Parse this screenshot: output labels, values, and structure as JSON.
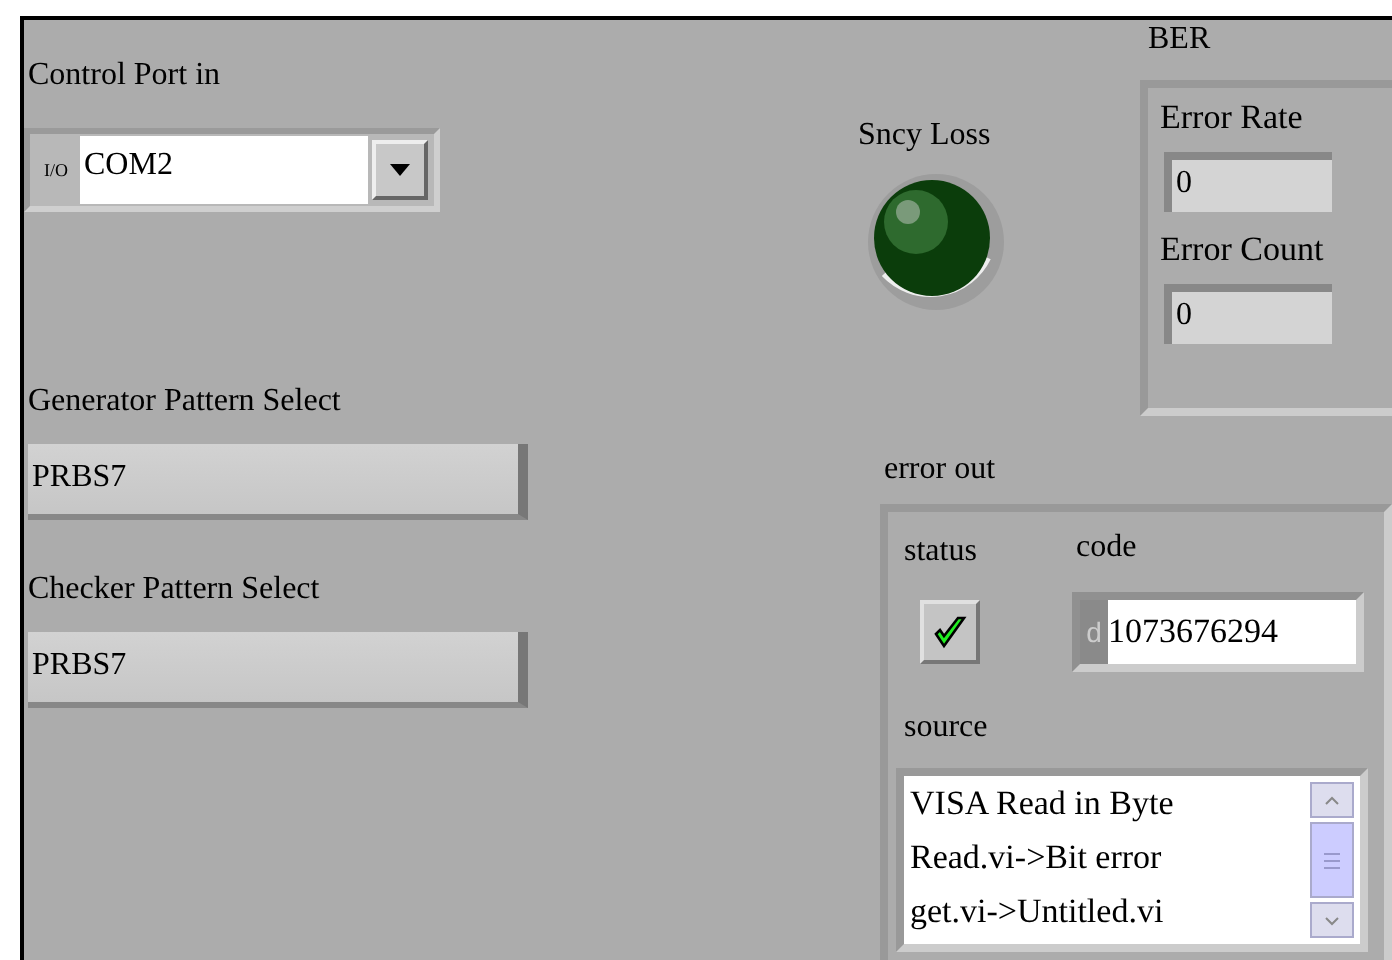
{
  "control_port": {
    "label": "Control Port in",
    "prefix": "I/O",
    "value": "COM2"
  },
  "sync_loss": {
    "label": "Sncy Loss",
    "on": false
  },
  "ber": {
    "label": "BER",
    "fields": [
      {
        "label": "Error Rate",
        "value": "0"
      },
      {
        "label": "Error Count",
        "value": "0"
      }
    ]
  },
  "pattern_selects": [
    {
      "label": "Generator Pattern Select",
      "value": "PRBS7"
    },
    {
      "label": "Checker Pattern Select",
      "value": "PRBS7"
    }
  ],
  "error_out": {
    "label": "error out",
    "status_label": "status",
    "status": {
      "checked": true
    },
    "code_label": "code",
    "code_prefix": "d",
    "code": "1073676294",
    "source_label": "source",
    "source_lines": [
      "VISA Read in Byte",
      "Read.vi->Bit error",
      "get.vi->Untitled.vi"
    ]
  }
}
